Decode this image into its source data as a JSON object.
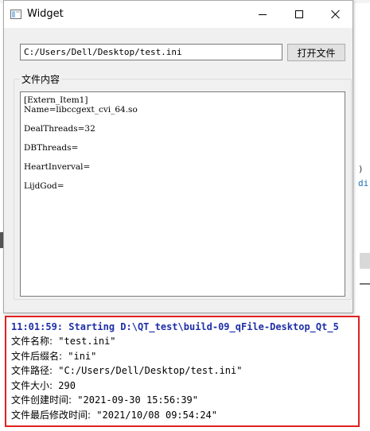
{
  "window": {
    "title": "Widget"
  },
  "toolbar": {
    "path_value": "C:/Users/Dell/Desktop/test.ini",
    "open_label": "打开文件"
  },
  "group": {
    "title": "文件内容"
  },
  "file_content": [
    "[Extern_Item1]",
    "Name=libccgext_cvi_64.so",
    "",
    "DealThreads=32",
    "",
    "DBThreads=",
    "",
    "HeartInverval=",
    "",
    "LijdGod="
  ],
  "background": {
    "right_fragment_1": ")",
    "right_fragment_2": "di"
  },
  "console": {
    "start_line": "11:01:59: Starting D:\\QT_test\\build-09_qFile-Desktop_Qt_5",
    "lines": [
      {
        "label": "文件名称:",
        "value": "\"test.ini\""
      },
      {
        "label": "文件后缀名:",
        "value": "\"ini\""
      },
      {
        "label": "文件路径:",
        "value": "\"C:/Users/Dell/Desktop/test.ini\""
      },
      {
        "label": "文件大小:",
        "value": "290"
      },
      {
        "label": "文件创建时间:",
        "value": "\"2021-09-30 15:56:39\""
      },
      {
        "label": "文件最后修改时间:",
        "value": "\"2021/10/08 09:54:24\""
      }
    ]
  },
  "colors": {
    "console_border": "#e02020",
    "console_start_text": "#1f2fa8",
    "window_bg": "#f0f0f0"
  }
}
